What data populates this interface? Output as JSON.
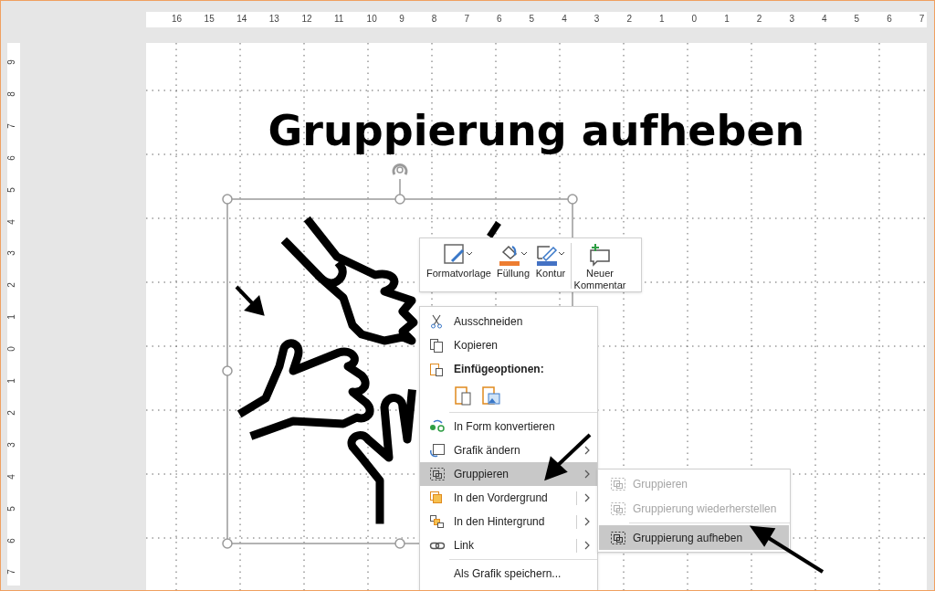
{
  "ruler_top": {
    "labels": [
      "16",
      "15",
      "14",
      "13",
      "12",
      "11",
      "10",
      "9",
      "8",
      "7",
      "6",
      "5",
      "4",
      "3",
      "2",
      "1",
      "0",
      "1",
      "2",
      "3",
      "4",
      "5",
      "6",
      "7"
    ]
  },
  "ruler_left": {
    "labels": [
      "9",
      "8",
      "7",
      "6",
      "5",
      "4",
      "3",
      "2",
      "1",
      "0",
      "1",
      "2",
      "3",
      "4",
      "5",
      "6",
      "7"
    ]
  },
  "slide": {
    "title": "Gruppierung aufheben"
  },
  "mini_toolbar": {
    "buttons": [
      {
        "label": "Formatvorlage"
      },
      {
        "label": "Füllung"
      },
      {
        "label": "Kontur"
      },
      {
        "label": "Neuer Kommentar"
      }
    ]
  },
  "context_menu": {
    "items": [
      {
        "kind": "item",
        "label": "Ausschneiden",
        "submenu": false,
        "split": false,
        "selected": false
      },
      {
        "kind": "item",
        "label": "Kopieren",
        "submenu": false,
        "split": false,
        "selected": false
      },
      {
        "kind": "header",
        "label": "Einfügeoptionen:"
      },
      {
        "kind": "paste_options"
      },
      {
        "kind": "separator"
      },
      {
        "kind": "item",
        "label": "In Form konvertieren",
        "submenu": false,
        "split": false,
        "selected": false
      },
      {
        "kind": "item",
        "label": "Grafik ändern",
        "submenu": true,
        "split": false,
        "selected": false
      },
      {
        "kind": "item",
        "label": "Gruppieren",
        "submenu": true,
        "split": false,
        "selected": true
      },
      {
        "kind": "item",
        "label": "In den Vordergrund",
        "submenu": true,
        "split": true,
        "selected": false
      },
      {
        "kind": "item",
        "label": "In den Hintergrund",
        "submenu": true,
        "split": true,
        "selected": false
      },
      {
        "kind": "item",
        "label": "Link",
        "submenu": true,
        "split": true,
        "selected": false
      },
      {
        "kind": "separator"
      },
      {
        "kind": "item",
        "label": "Als Grafik speichern...",
        "submenu": false,
        "split": false,
        "selected": false
      }
    ]
  },
  "submenu": {
    "items": [
      {
        "kind": "item",
        "label": "Gruppieren",
        "disabled": true,
        "selected": false
      },
      {
        "kind": "item",
        "label": "Gruppierung wiederherstellen",
        "disabled": true,
        "selected": false
      },
      {
        "kind": "separator"
      },
      {
        "kind": "item",
        "label": "Gruppierung aufheben",
        "disabled": false,
        "selected": true
      }
    ]
  }
}
